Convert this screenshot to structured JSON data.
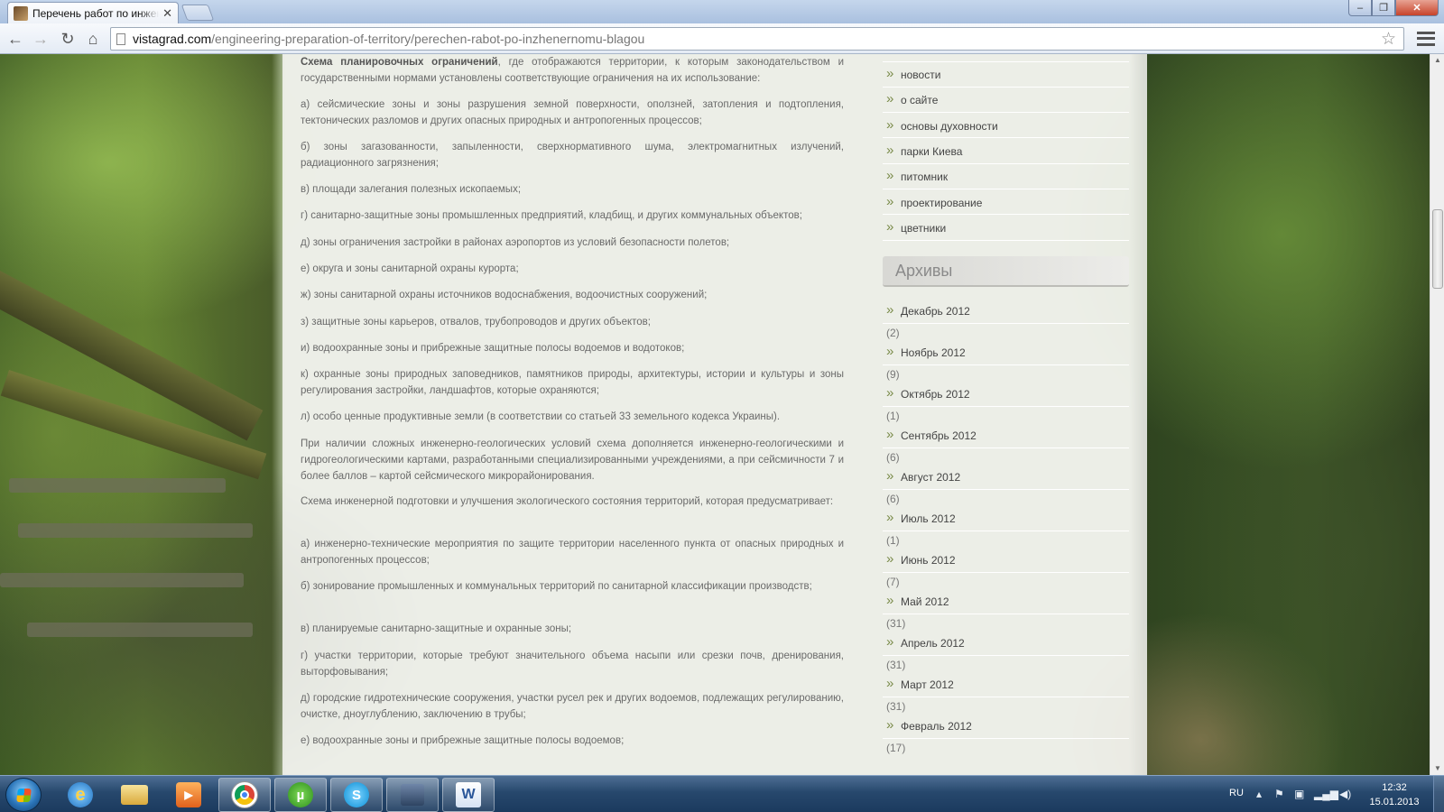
{
  "browser": {
    "tab_title": "Перечень работ по инженерной",
    "tab_close": "✕",
    "url_host": "vistagrad.com",
    "url_path": "/engineering-preparation-of-territory/perechen-rabot-po-inzhenernomu-blagou",
    "icons": {
      "back": "arrow-left-icon",
      "forward": "arrow-right-icon",
      "reload": "reload-icon",
      "home": "home-icon",
      "bookmark": "star-icon",
      "menu": "menu-icon"
    }
  },
  "article": {
    "p1_bold": "Схема планировочных ограничений",
    "p1_rest": ", где отображаются территории, к которым законодательством и государственными нормами установлены соответствующие ограничения на их использование:",
    "paragraphs": [
      "а) сейсмические зоны и зоны разрушения земной поверхности, оползней, затопления и подтопления, тектонических разломов и других опасных природных и антропогенных процессов;",
      "б) зоны загазованности, запыленности, сверхнормативного шума, электромагнитных излучений, радиационного загрязнения;",
      "в) площади залегания полезных ископаемых;",
      "г) санитарно-защитные зоны промышленных предприятий, кладбищ, и других коммунальных объектов;",
      "д) зоны ограничения застройки в районах аэропортов из условий безопасности полетов;",
      "е) округа и зоны санитарной охраны курорта;",
      "ж) зоны санитарной охраны источников водоснабжения, водоочистных сооружений;",
      "з) защитные зоны карьеров, отвалов, трубопроводов и других объектов;",
      "и) водоохранные зоны и прибрежные защитные полосы водоемов и водотоков;",
      "к) охранные зоны природных заповедников, памятников природы, архитектуры, истории и культуры и зоны регулирования застройки, ландшафтов, которые охраняются;",
      "л) особо ценные продуктивные земли (в соответствии со статьей 33 земельного кодекса Украины).",
      "При наличии сложных инженерно-геологических условий схема дополняется инженерно-геологическими и гидрогеологическими картами, разработанными специализированными учреждениями, а при сейсмичности 7 и более баллов – картой сейсмического микрорайонирования.",
      "Схема инженерной подготовки и улучшения экологического состояния территорий, которая предусматривает:",
      "а) инженерно-технические мероприятия по защите территории населенного пункта от опасных природных и антропогенных процессов;",
      "б) зонирование промышленных и коммунальных территорий по санитарной классификации производств;",
      "в) планируемые санитарно-защитные и охранные зоны;",
      "г) участки территории, которые требуют значительного объема насыпи или срезки почв, дренирования, выторфовывания;",
      "д) городские гидротехнические сооружения, участки русел рек и других водоемов, подлежащих регулированию, очистке, дноуглублению, заключению в трубы;",
      "е) водоохранные зоны и прибрежные защитные полосы водоемов;"
    ]
  },
  "sidebar": {
    "categories": [
      "новости",
      "о сайте",
      "основы духовности",
      "парки Киева",
      "питомник",
      "проектирование",
      "цветники"
    ],
    "archives_heading": "Архивы",
    "archives": [
      {
        "label": "Декабрь 2012",
        "count": "(2)"
      },
      {
        "label": "Ноябрь 2012",
        "count": "(9)"
      },
      {
        "label": "Октябрь 2012",
        "count": "(1)"
      },
      {
        "label": "Сентябрь 2012",
        "count": "(6)"
      },
      {
        "label": "Август 2012",
        "count": "(6)"
      },
      {
        "label": "Июль 2012",
        "count": "(1)"
      },
      {
        "label": "Июнь 2012",
        "count": "(7)"
      },
      {
        "label": "Май 2012",
        "count": "(31)"
      },
      {
        "label": "Апрель 2012",
        "count": "(31)"
      },
      {
        "label": "Март 2012",
        "count": "(31)"
      },
      {
        "label": "Февраль 2012",
        "count": "(17)"
      }
    ]
  },
  "taskbar": {
    "apps": [
      "internet-explorer-icon",
      "file-explorer-icon",
      "media-player-icon",
      "chrome-icon",
      "utorrent-icon",
      "skype-icon",
      "computer-icon",
      "word-icon"
    ],
    "language": "RU",
    "time": "12:32",
    "date": "15.01.2013"
  }
}
